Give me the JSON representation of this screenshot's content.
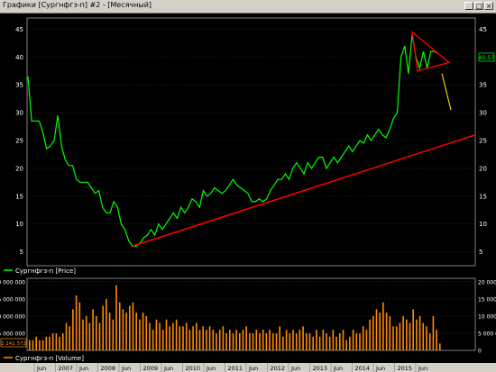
{
  "window": {
    "title": "Графики [Сургнфгз-п] #2 - [Месячный]",
    "controls": [
      "_",
      "□",
      "×"
    ]
  },
  "price_panel": {
    "y_ticks": [
      "45",
      "40",
      "35",
      "30",
      "25",
      "20",
      "15",
      "10",
      "5"
    ],
    "current_value_label": "40.57",
    "legend": "Сургнфгз-п [Price]",
    "series_color": "#00ff00",
    "trendline_color": "#ff0000",
    "triangle_color": "#ff0000",
    "projection_color": "#ffff00"
  },
  "volume_panel": {
    "y_ticks": [
      "20 000 000",
      "15 000 000",
      "10 000 000",
      "5 000 000",
      "0"
    ],
    "current_value_label": "2 241 572",
    "legend": "Сургнфгз-п [Volume]",
    "series_color": "#ff8c00"
  },
  "x_axis": {
    "labels": [
      "Jun",
      "2007",
      "Jun",
      "2008",
      "Jun",
      "2009",
      "Jun",
      "2010",
      "Jun",
      "2011",
      "Jun",
      "2012",
      "Jun",
      "2013",
      "Jun",
      "2014",
      "Jun",
      "2015",
      "Jun"
    ]
  },
  "chart_data": [
    {
      "type": "line",
      "title": "",
      "series": [
        {
          "name": "Сургнфгз-п [Price]",
          "values": [
            36.5,
            28.5,
            28.5,
            28.5,
            26.5,
            23.5,
            24,
            25,
            29.5,
            24,
            21.5,
            20.5,
            20.5,
            18,
            17.5,
            17.5,
            17.5,
            16.5,
            15.5,
            16,
            13,
            12,
            12,
            14,
            13,
            10,
            9,
            7,
            6,
            6,
            6.5,
            7.5,
            8,
            9,
            8,
            10,
            9,
            10,
            11,
            12,
            11,
            13,
            12,
            13,
            14.5,
            14,
            13,
            16,
            15,
            15.5,
            16.5,
            16,
            15.5,
            16,
            17,
            18,
            17,
            16.5,
            16,
            15.5,
            14,
            14,
            14.5,
            14,
            14.5,
            16,
            17,
            18,
            18,
            19,
            18,
            20,
            21,
            20,
            19,
            21,
            20,
            21,
            22,
            22,
            20,
            21,
            22,
            21,
            22,
            23,
            24,
            23,
            24,
            25,
            24.5,
            26,
            25,
            26,
            27,
            26,
            25.5,
            27,
            29,
            30,
            40,
            42,
            37,
            44,
            40,
            38,
            41,
            38,
            41,
            41,
            40.6
          ]
        }
      ],
      "trendline": {
        "from": {
          "x_label": "Jun 2009",
          "y": 6
        },
        "to": {
          "x_label": "end",
          "y": 26
        }
      },
      "ylim": [
        2.5,
        47
      ],
      "y_ticks": [
        5,
        10,
        15,
        20,
        25,
        30,
        35,
        40,
        45
      ]
    },
    {
      "type": "bar",
      "title": "",
      "series": [
        {
          "name": "Сургнфгз-п [Volume]",
          "values": [
            3,
            3,
            4,
            3,
            3,
            4,
            4,
            5,
            5,
            4,
            5,
            8,
            7,
            12,
            16,
            14,
            9,
            10,
            8,
            12,
            10,
            8,
            13,
            15,
            11,
            9,
            19,
            14,
            12,
            11,
            13,
            14,
            11,
            9,
            11,
            10,
            8,
            6,
            9,
            8,
            6,
            9,
            7,
            8,
            9,
            7,
            7,
            8,
            6,
            7,
            8,
            6,
            7,
            6,
            7,
            6,
            5,
            6,
            7,
            5,
            6,
            5,
            6,
            5,
            6,
            7,
            5,
            5,
            6,
            5,
            6,
            5,
            6,
            5,
            5,
            7,
            4,
            6,
            5,
            6,
            5,
            6,
            7,
            5,
            5,
            4,
            6,
            4,
            6,
            5,
            4,
            6,
            4,
            5,
            6,
            3,
            4,
            6,
            5,
            5,
            7,
            6,
            9,
            10,
            12,
            11,
            14,
            11,
            10,
            7,
            7,
            8,
            10,
            9,
            8,
            12,
            9,
            10,
            8,
            7,
            5,
            10,
            6,
            2
          ]
        }
      ],
      "ylim": [
        0,
        21000000
      ],
      "unit_note": "values in millions"
    }
  ]
}
